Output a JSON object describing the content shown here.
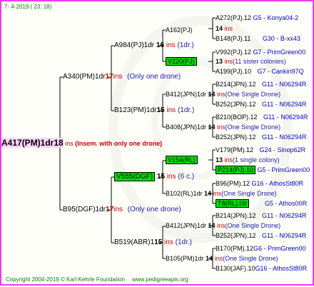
{
  "header": {
    "date": "7-  4-2019 ( 23: 18)"
  },
  "footer": {
    "copyright": "Copyright 2004-2019 © Karl Kehrle Foundation",
    "url": "www.pedigreeapis.org"
  },
  "gen1": {
    "name": "A417(PM)1dr",
    "num": "18",
    "ins": "ins",
    "note": "(Insem. with only one drone)"
  },
  "gen2": [
    {
      "name": "A340(PM)1dr",
      "num": "17",
      "ins": "ins",
      "note": "(Only one drone)"
    },
    {
      "name": "B95(DGF)1dr",
      "num": "17",
      "ins": "ins",
      "note": "(Only one drone)"
    }
  ],
  "gen3": [
    {
      "name": "A984(PJ)1dr",
      "num": "16",
      "ins": "ins",
      "note": "(1dr.)"
    },
    {
      "name": "B123(PM)1dr",
      "num": "15",
      "ins": "ins",
      "note": "(1dr.)"
    },
    {
      "name": "V555(DGF)",
      "num": "15",
      "ins": "ins",
      "note": "(6 c.)"
    },
    {
      "name": "B519(ABR)1",
      "num": "15",
      "ins": "ins",
      "note": "(1dr.)"
    }
  ],
  "gen4": [
    {
      "name": "A162(PJ)",
      "num": "14",
      "ins": "ins",
      "note": ""
    },
    {
      "name": "V220(PJ)",
      "num": "13",
      "ins": "ins",
      "note": "(11 sister colonies)"
    },
    {
      "name": "B412(JPN)1dr",
      "num": "14",
      "ins": "ins",
      "note": "(One Single Drone)"
    },
    {
      "name": "B408(JPN)1dr",
      "num": "14",
      "ins": "ins",
      "note": "(One Single Drone)"
    },
    {
      "name": "V154(RL)",
      "num": "13",
      "ins": "ins",
      "note": "(1 single colony)"
    },
    {
      "name": "B102(RL)1dr",
      "num": "14",
      "ins": "ins",
      "note": "(One Single Drone)"
    },
    {
      "name": "B412(JPN)1dr",
      "num": "14",
      "ins": "ins",
      "note": "(One Single Drone)"
    },
    {
      "name": "B105(PM)1dr",
      "num": "14",
      "ins": "ins",
      "note": "(One Single Drone)"
    }
  ],
  "gen5": [
    {
      "name": "A272(PJ).12",
      "info": "G5 - Konya04-2"
    },
    {
      "name": "B148(PJ).11",
      "info": "G30 - B-xx43"
    },
    {
      "name": "V992(PJ).12",
      "info": "G7 - PrimGreen00"
    },
    {
      "name": "A199(PJ).10",
      "info": "G7 - Cankiri97Q"
    },
    {
      "name": "B214(JPN).12",
      "info": "G11 - N06294R"
    },
    {
      "name": "B252(JPN).12",
      "info": "G11 - N06294R"
    },
    {
      "name": "B210(BOP).12",
      "info": "G11 - N06294R"
    },
    {
      "name": "B252(JPN).12",
      "info": "G11 - N06294R"
    },
    {
      "name": "V179(PM).12",
      "info": "G24 - Sinop62R"
    },
    {
      "name": "P214(PJ).10",
      "info": "G5 - PrimGreen00"
    },
    {
      "name": "B96(PM).12",
      "info": "G16 - AthosSt80R"
    },
    {
      "name": "T8(RL).09",
      "info": "G5 - Athos00R"
    },
    {
      "name": "B214(JPN).12",
      "info": "G11 - N06294R"
    },
    {
      "name": "B252(JPN).12",
      "info": "G11 - N06294R"
    },
    {
      "name": "B170(PM).12",
      "info": "G6 - PrimGreen00"
    },
    {
      "name": "B130(JAF).10",
      "info": "G16 - AthosSt80R"
    }
  ]
}
